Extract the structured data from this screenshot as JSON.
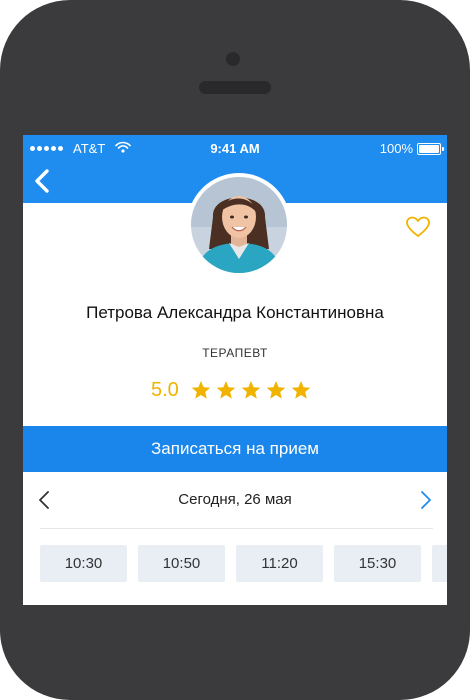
{
  "status_bar": {
    "carrier": "AT&T",
    "time": "9:41 AM",
    "battery": "100%"
  },
  "doctor": {
    "name": "Петрова Александра Константиновна",
    "specialty": "ТЕРАПЕВТ",
    "rating": "5.0",
    "stars": 5,
    "favorite": false
  },
  "actions": {
    "book_label": "Записаться на прием"
  },
  "schedule": {
    "date_label": "Сегодня, 26 мая",
    "slots": [
      "10:30",
      "10:50",
      "11:20",
      "15:30"
    ]
  },
  "colors": {
    "accent": "#1f8cf0",
    "star": "#f0b400",
    "slot_bg": "#e9eef5"
  },
  "icons": {
    "back": "chevron-left-icon",
    "favorite": "heart-outline-icon",
    "prev": "chevron-left-icon",
    "next": "chevron-right-icon"
  }
}
